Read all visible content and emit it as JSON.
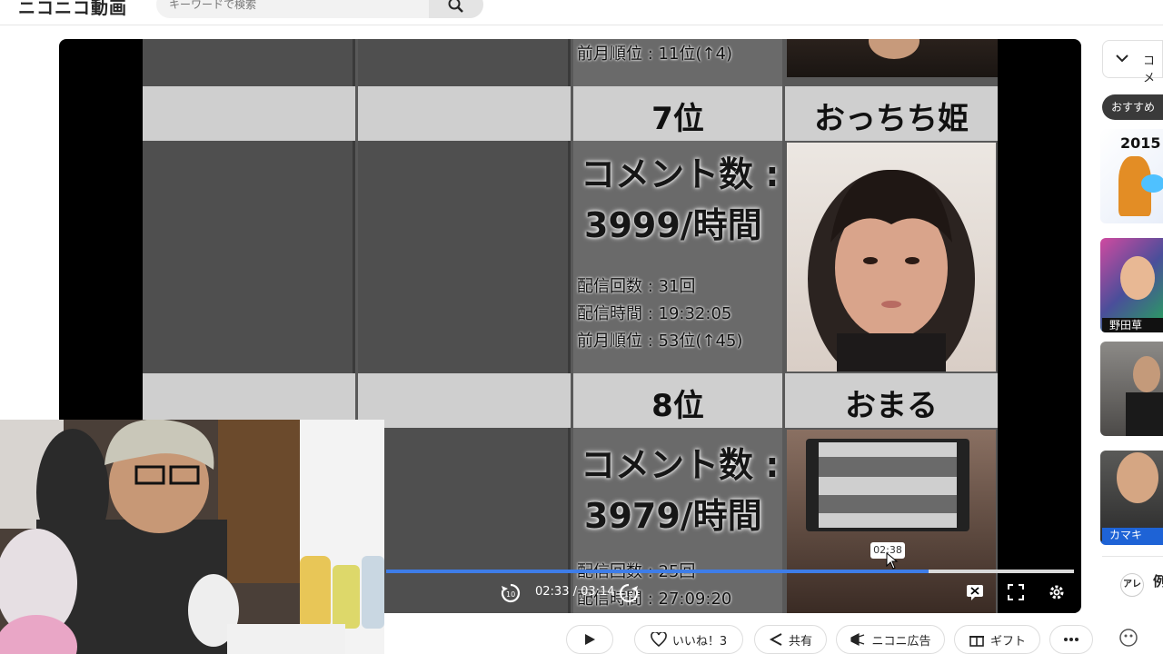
{
  "header": {
    "logo": "ニコニコ動画",
    "search_placeholder": "キーワードで検索"
  },
  "video": {
    "top_row": {
      "prev_rank": "前月順位 : 11位(↑4)"
    },
    "rank7": {
      "rank": "7位",
      "name": "おっちち姫",
      "comment_label": "コメント数 :",
      "comment_value": "3999/時間",
      "streams": "配信回数 : 31回",
      "duration": "配信時間 : 19:32:05",
      "prev_rank": "前月順位 : 53位(↑45)"
    },
    "rank8": {
      "rank": "8位",
      "name": "おまる",
      "comment_label": "コメント数 :",
      "comment_value": "3979/時間",
      "streams": "配信回数 : 25回",
      "duration": "配信時間 : 27:09:20"
    }
  },
  "player": {
    "hover_time": "02:38",
    "timecode": "02:33 / 03:14",
    "progress_fraction": 0.789
  },
  "actions": {
    "like": "いいね！3",
    "share": "共有",
    "ad": "ニコニ広告",
    "gift": "ギフト"
  },
  "sidebar": {
    "header_label": "コメ",
    "recommend_pill": "おすすめ",
    "items": [
      {
        "caption": "2015"
      },
      {
        "caption": "野田草"
      },
      {
        "caption": ""
      },
      {
        "caption": "カマキ"
      }
    ],
    "footer_label": "例",
    "footer_avatar": "アレ"
  },
  "colors": {
    "progress": "#3e7de8",
    "accent_blue": "#1e63d6"
  }
}
